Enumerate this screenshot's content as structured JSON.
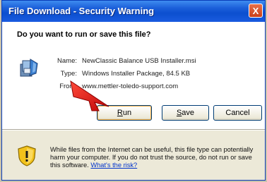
{
  "window": {
    "title": "File Download - Security Warning",
    "close_glyph": "X"
  },
  "prompt": {
    "question": "Do you want to run or save this file?"
  },
  "file_info": {
    "icon": "installer-package-icon",
    "name_label": "Name:",
    "name_value": "NewClassic Balance USB Installer.msi",
    "type_label": "Type:",
    "type_value": "Windows Installer Package, 84.5 KB",
    "from_label": "From:",
    "from_value": "www.mettler-toledo-support.com"
  },
  "buttons": {
    "run_accel": "R",
    "run_rest": "un",
    "save_accel": "S",
    "save_rest": "ave",
    "cancel_label": "Cancel"
  },
  "warning": {
    "icon": "shield-warning-icon",
    "text": "While files from the Internet can be useful, this file type can potentially harm your computer. If you do not trust the source, do not run or save this software. ",
    "link_text": "What's the risk?"
  },
  "colors": {
    "title_bar": "#1b5fd9",
    "dialog_bg": "#ece9d8",
    "link": "#0033cc",
    "arrow": "#e01010",
    "shield": "#f2c21b"
  },
  "annotation": {
    "icon": "red-arrow-pointer"
  }
}
